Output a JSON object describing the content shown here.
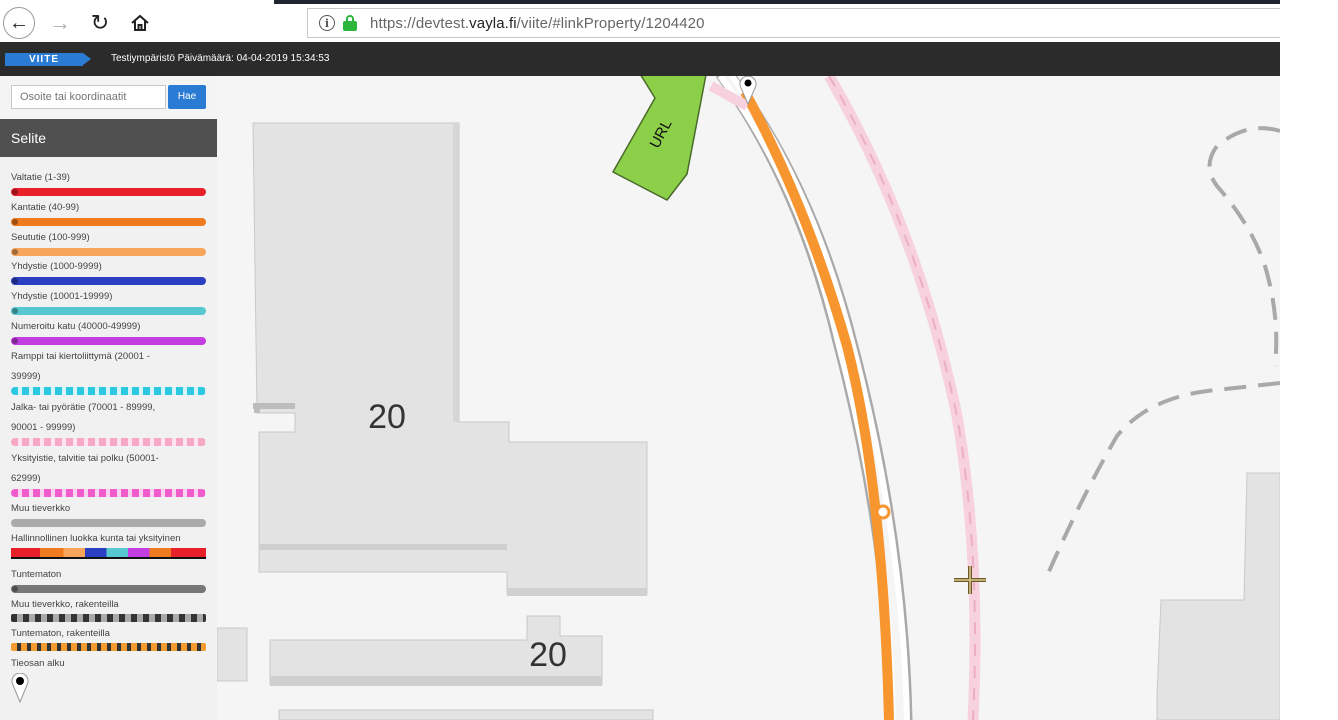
{
  "browser": {
    "url_prefix": "https://devtest.",
    "url_domain": "vayla.fi",
    "url_suffix": "/viite/#linkProperty/1204420"
  },
  "app": {
    "logo_text": "VIITE",
    "environment_text": "Testiympäristö Päivämäärä: 04-04-2019 15:34:53"
  },
  "search": {
    "placeholder": "Osoite tai koordinaatit",
    "button_label": "Hae"
  },
  "legend": {
    "title": "Selite",
    "items": [
      {
        "label": "Valtatie (1-39)",
        "color": "#e8202a"
      },
      {
        "label": "Kantatie (40-99)",
        "color": "#f07a1e"
      },
      {
        "label": "Seututie (100-999)",
        "color": "#f6a55a"
      },
      {
        "label": "Yhdystie (1000-9999)",
        "color": "#2b3fc2"
      },
      {
        "label": "Yhdystie (10001-19999)",
        "color": "#57c7d0"
      },
      {
        "label": "Numeroitu katu (40000-49999)",
        "color": "#c33ee0"
      },
      {
        "label_line1": "Ramppi tai kiertoliittymä (20001 -",
        "label_line2": "39999)",
        "color": "#2cc8e0"
      },
      {
        "label_line1": "Jalka- tai pyörätie (70001 - 89999,",
        "label_line2": "90001 - 99999)",
        "color": "#f5a9c4"
      },
      {
        "label_line1": "Yksityistie, talvitie tai polku (50001-",
        "label_line2": "62999)",
        "color": "#f05ccc"
      },
      {
        "label": "Muu tieverkko",
        "color": "#aaaaaa"
      },
      {
        "label": "Hallinnollinen luokka kunta tai yksityinen",
        "color": "#e8202a"
      },
      {
        "label": "Tuntematon",
        "color": "#777777"
      },
      {
        "label": "Muu tieverkko, rakenteilla",
        "color": "#9a9a9a"
      },
      {
        "label": "Tuntematon, rakenteilla",
        "color": "#f29b30"
      },
      {
        "label": "Tieosan alku",
        "icon": "map-pin-icon"
      }
    ]
  },
  "map": {
    "building_numbers": [
      "20",
      "20"
    ],
    "annotation_label": "URL",
    "road_color": "#f7952f",
    "arrow_color": "#8cd04a"
  }
}
